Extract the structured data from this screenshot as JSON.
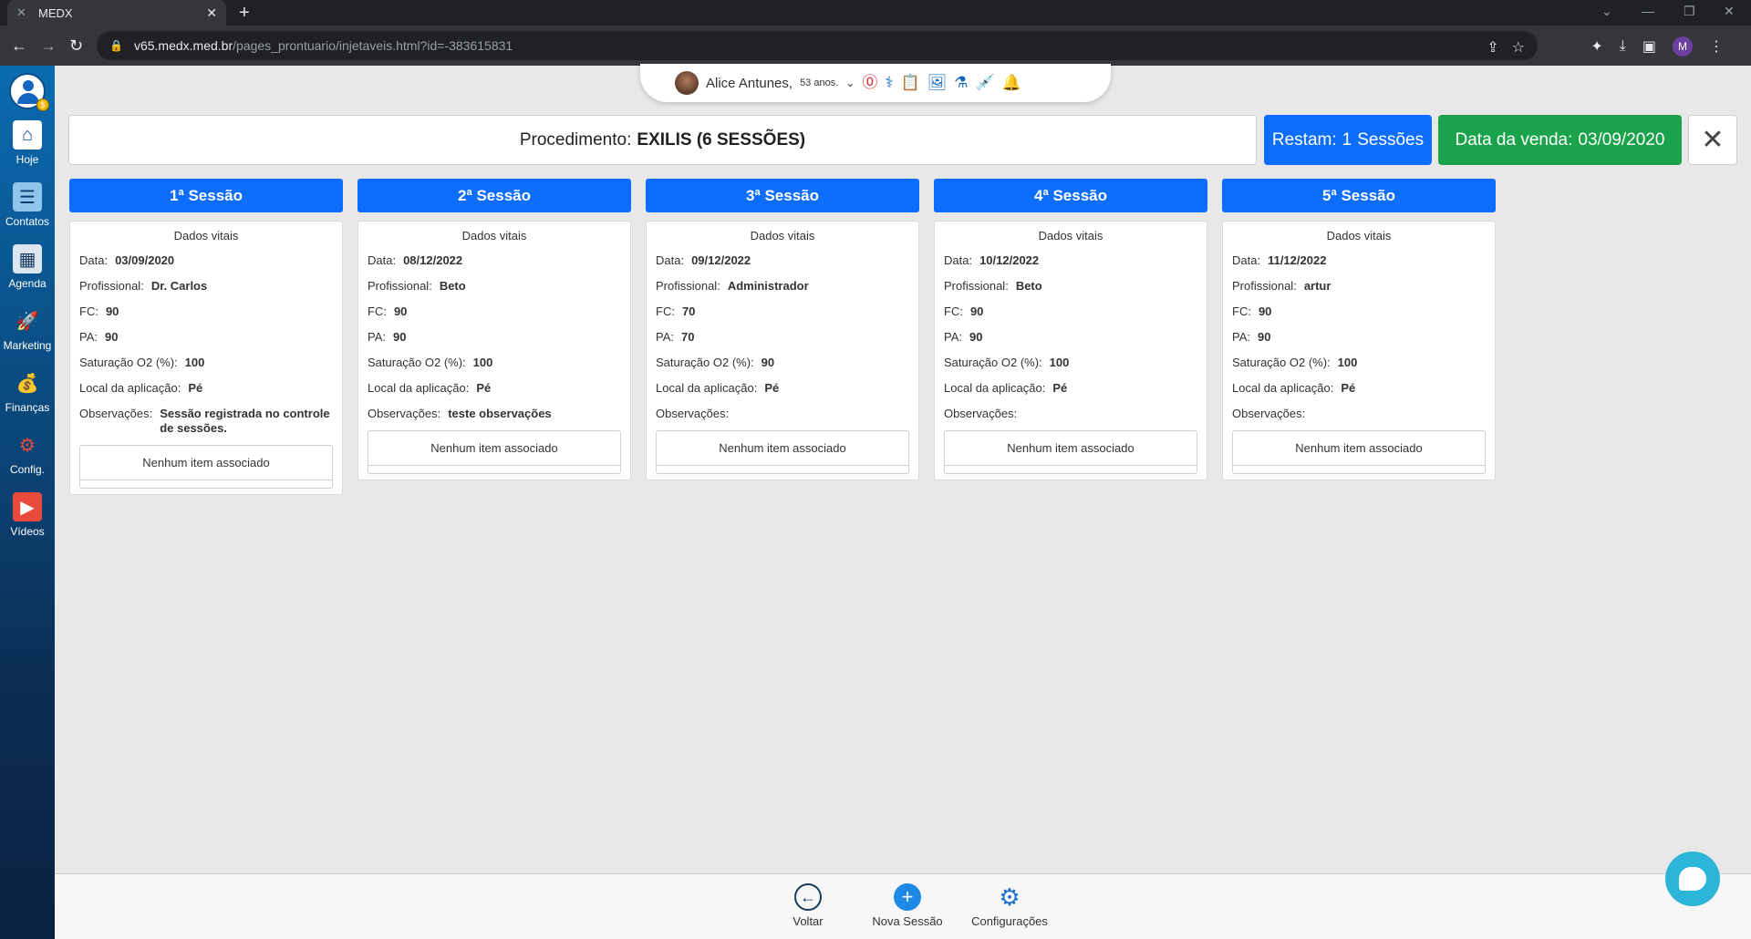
{
  "browser": {
    "tab_title": "MEDX",
    "url_host": "v65.medx.med.br",
    "url_path": "/pages_prontuario/injetaveis.html?id=-383615831",
    "profile_initial": "M"
  },
  "sidebar": {
    "items": [
      {
        "label": "Hoje",
        "icon": "home-icon"
      },
      {
        "label": "Contatos",
        "icon": "contacts-icon"
      },
      {
        "label": "Agenda",
        "icon": "calendar-icon"
      },
      {
        "label": "Marketing",
        "icon": "rocket-icon"
      },
      {
        "label": "Finanças",
        "icon": "money-bag-icon"
      },
      {
        "label": "Config.",
        "icon": "gear-icon"
      },
      {
        "label": "Vídeos",
        "icon": "video-icon"
      }
    ]
  },
  "patient": {
    "name": "Alice Antunes,",
    "age": "53 anos."
  },
  "procedure": {
    "label": "Procedimento:",
    "name": "EXILIS (6 SESSÕES)"
  },
  "restam": {
    "prefix": "Restam:",
    "count": "1",
    "suffix": "Sessões"
  },
  "venda": {
    "label": "Data da venda:",
    "date": "03/09/2020"
  },
  "labels": {
    "vitals": "Dados vitais",
    "data": "Data:",
    "profissional": "Profissional:",
    "fc": "FC:",
    "pa": "PA:",
    "saturacao": "Saturação O2 (%):",
    "local": "Local da aplicação:",
    "obs": "Observações:",
    "no_items": "Nenhum item associado"
  },
  "sessions": [
    {
      "title": "1ª Sessão",
      "data": "03/09/2020",
      "profissional": "Dr. Carlos",
      "fc": "90",
      "pa": "90",
      "saturacao": "100",
      "local": "Pé",
      "obs": "Sessão registrada no controle de sessões."
    },
    {
      "title": "2ª Sessão",
      "data": "08/12/2022",
      "profissional": "Beto",
      "fc": "90",
      "pa": "90",
      "saturacao": "100",
      "local": "Pé",
      "obs": "teste observações"
    },
    {
      "title": "3ª Sessão",
      "data": "09/12/2022",
      "profissional": "Administrador",
      "fc": "70",
      "pa": "70",
      "saturacao": "90",
      "local": "Pé",
      "obs": ""
    },
    {
      "title": "4ª Sessão",
      "data": "10/12/2022",
      "profissional": "Beto",
      "fc": "90",
      "pa": "90",
      "saturacao": "100",
      "local": "Pé",
      "obs": ""
    },
    {
      "title": "5ª Sessão",
      "data": "11/12/2022",
      "profissional": "artur",
      "fc": "90",
      "pa": "90",
      "saturacao": "100",
      "local": "Pé",
      "obs": ""
    }
  ],
  "bottom": {
    "voltar": "Voltar",
    "nova_sessao": "Nova Sessão",
    "configuracoes": "Configurações"
  },
  "colors": {
    "primary": "#0d6efd",
    "success": "#1aa34a",
    "sidebar_top": "#0a6bb0",
    "sidebar_bottom": "#0a2140",
    "chat": "#2bb5d8"
  }
}
